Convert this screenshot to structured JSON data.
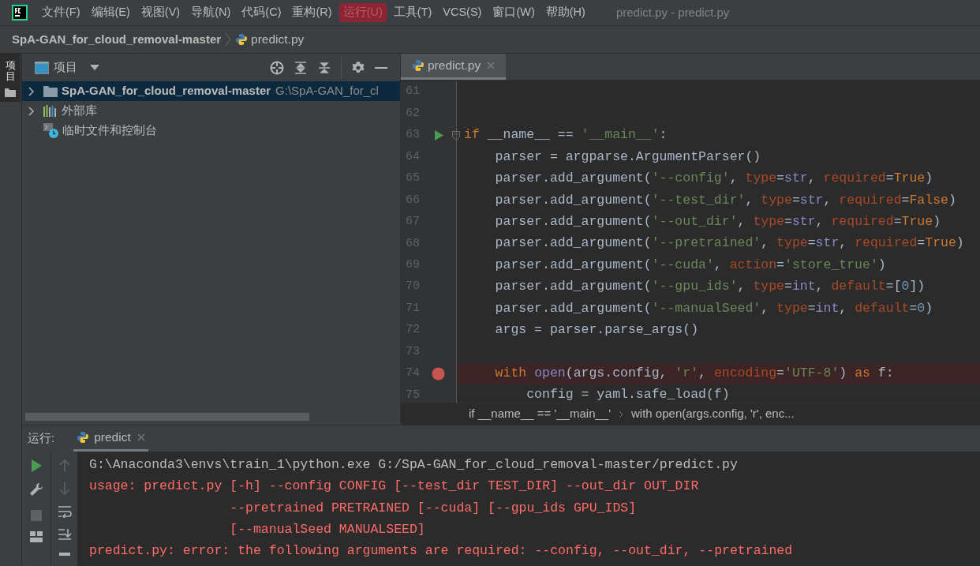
{
  "menu_bar": {
    "items": [
      {
        "label": "文件(F)",
        "selected": false
      },
      {
        "label": "编辑(E)",
        "selected": false
      },
      {
        "label": "视图(V)",
        "selected": false
      },
      {
        "label": "导航(N)",
        "selected": false
      },
      {
        "label": "代码(C)",
        "selected": false
      },
      {
        "label": "重构(R)",
        "selected": false
      },
      {
        "label": "运行(U)",
        "selected": true
      },
      {
        "label": "工具(T)",
        "selected": false
      },
      {
        "label": "VCS(S)",
        "selected": false
      },
      {
        "label": "窗口(W)",
        "selected": false
      },
      {
        "label": "帮助(H)",
        "selected": false
      }
    ],
    "window_title": "predict.py - predict.py"
  },
  "breadcrumb": {
    "project": "SpA-GAN_for_cloud_removal-master",
    "file": "predict.py"
  },
  "side_stripe": {
    "tab": "项目"
  },
  "project_panel": {
    "title": "项目",
    "tree": [
      {
        "kind": "folder",
        "label": "SpA-GAN_for_cloud_removal-master",
        "path": "G:\\SpA-GAN_for_cl",
        "expanded": false,
        "selected": true
      },
      {
        "kind": "library",
        "label": "外部库",
        "expanded": false,
        "selected": false
      },
      {
        "kind": "scratch",
        "label": "临时文件和控制台",
        "selected": false
      }
    ]
  },
  "editor": {
    "tabs": [
      {
        "label": "predict.py",
        "selected": true
      }
    ],
    "lines": [
      {
        "number": "61"
      },
      {
        "number": "62"
      },
      {
        "number": "63",
        "run_marker": true,
        "fold": true,
        "tokens": [
          {
            "kind": "keyword",
            "text": "if "
          },
          {
            "kind": "plain",
            "text": "__name__ == "
          },
          {
            "kind": "string",
            "text": "'__main__'"
          },
          {
            "kind": "plain",
            "text": ":"
          }
        ]
      },
      {
        "number": "64",
        "tokens": [
          {
            "kind": "plain",
            "text": "    parser = argparse.ArgumentParser()"
          }
        ]
      },
      {
        "number": "65",
        "tokens": [
          {
            "kind": "plain",
            "text": "    parser.add_argument("
          },
          {
            "kind": "string",
            "text": "'--config'"
          },
          {
            "kind": "plain",
            "text": ", "
          },
          {
            "kind": "param",
            "text": "type"
          },
          {
            "kind": "plain",
            "text": "="
          },
          {
            "kind": "builtin",
            "text": "str"
          },
          {
            "kind": "plain",
            "text": ", "
          },
          {
            "kind": "param",
            "text": "required"
          },
          {
            "kind": "plain",
            "text": "="
          },
          {
            "kind": "keyword",
            "text": "True"
          },
          {
            "kind": "plain",
            "text": ")"
          }
        ]
      },
      {
        "number": "66",
        "tokens": [
          {
            "kind": "plain",
            "text": "    parser.add_argument("
          },
          {
            "kind": "string",
            "text": "'--test_dir'"
          },
          {
            "kind": "plain",
            "text": ", "
          },
          {
            "kind": "param",
            "text": "type"
          },
          {
            "kind": "plain",
            "text": "="
          },
          {
            "kind": "builtin",
            "text": "str"
          },
          {
            "kind": "plain",
            "text": ", "
          },
          {
            "kind": "param",
            "text": "required"
          },
          {
            "kind": "plain",
            "text": "="
          },
          {
            "kind": "keyword",
            "text": "False"
          },
          {
            "kind": "plain",
            "text": ")"
          }
        ]
      },
      {
        "number": "67",
        "tokens": [
          {
            "kind": "plain",
            "text": "    parser.add_argument("
          },
          {
            "kind": "string",
            "text": "'--out_dir'"
          },
          {
            "kind": "plain",
            "text": ", "
          },
          {
            "kind": "param",
            "text": "type"
          },
          {
            "kind": "plain",
            "text": "="
          },
          {
            "kind": "builtin",
            "text": "str"
          },
          {
            "kind": "plain",
            "text": ", "
          },
          {
            "kind": "param",
            "text": "required"
          },
          {
            "kind": "plain",
            "text": "="
          },
          {
            "kind": "keyword",
            "text": "True"
          },
          {
            "kind": "plain",
            "text": ")"
          }
        ]
      },
      {
        "number": "68",
        "tokens": [
          {
            "kind": "plain",
            "text": "    parser.add_argument("
          },
          {
            "kind": "string",
            "text": "'--pretrained'"
          },
          {
            "kind": "plain",
            "text": ", "
          },
          {
            "kind": "param",
            "text": "type"
          },
          {
            "kind": "plain",
            "text": "="
          },
          {
            "kind": "builtin",
            "text": "str"
          },
          {
            "kind": "plain",
            "text": ", "
          },
          {
            "kind": "param",
            "text": "required"
          },
          {
            "kind": "plain",
            "text": "="
          },
          {
            "kind": "keyword",
            "text": "True"
          },
          {
            "kind": "plain",
            "text": ")"
          }
        ]
      },
      {
        "number": "69",
        "tokens": [
          {
            "kind": "plain",
            "text": "    parser.add_argument("
          },
          {
            "kind": "string",
            "text": "'--cuda'"
          },
          {
            "kind": "plain",
            "text": ", "
          },
          {
            "kind": "param",
            "text": "action"
          },
          {
            "kind": "plain",
            "text": "="
          },
          {
            "kind": "string",
            "text": "'store_true'"
          },
          {
            "kind": "plain",
            "text": ")"
          }
        ]
      },
      {
        "number": "70",
        "tokens": [
          {
            "kind": "plain",
            "text": "    parser.add_argument("
          },
          {
            "kind": "string",
            "text": "'--gpu_ids'"
          },
          {
            "kind": "plain",
            "text": ", "
          },
          {
            "kind": "param",
            "text": "type"
          },
          {
            "kind": "plain",
            "text": "="
          },
          {
            "kind": "builtin",
            "text": "int"
          },
          {
            "kind": "plain",
            "text": ", "
          },
          {
            "kind": "param",
            "text": "default"
          },
          {
            "kind": "plain",
            "text": "=["
          },
          {
            "kind": "number",
            "text": "0"
          },
          {
            "kind": "plain",
            "text": "])"
          }
        ]
      },
      {
        "number": "71",
        "tokens": [
          {
            "kind": "plain",
            "text": "    parser.add_argument("
          },
          {
            "kind": "string",
            "text": "'--manualSeed'"
          },
          {
            "kind": "plain",
            "text": ", "
          },
          {
            "kind": "param",
            "text": "type"
          },
          {
            "kind": "plain",
            "text": "="
          },
          {
            "kind": "builtin",
            "text": "int"
          },
          {
            "kind": "plain",
            "text": ", "
          },
          {
            "kind": "param",
            "text": "default"
          },
          {
            "kind": "plain",
            "text": "="
          },
          {
            "kind": "number",
            "text": "0"
          },
          {
            "kind": "plain",
            "text": ")"
          }
        ]
      },
      {
        "number": "72",
        "tokens": [
          {
            "kind": "plain",
            "text": "    args = parser.parse_args()"
          }
        ]
      },
      {
        "number": "73"
      },
      {
        "number": "74",
        "breakpoint": true,
        "highlighted": true,
        "tokens": [
          {
            "kind": "keyword",
            "text": "    with "
          },
          {
            "kind": "builtin",
            "text": "open"
          },
          {
            "kind": "plain",
            "text": "(args.config, "
          },
          {
            "kind": "string",
            "text": "'r'"
          },
          {
            "kind": "plain",
            "text": ", "
          },
          {
            "kind": "param",
            "text": "encoding"
          },
          {
            "kind": "plain",
            "text": "="
          },
          {
            "kind": "string",
            "text": "'UTF-8'"
          },
          {
            "kind": "plain",
            "text": ") "
          },
          {
            "kind": "keyword",
            "text": "as "
          },
          {
            "kind": "plain",
            "text": "f:"
          }
        ]
      },
      {
        "number": "75",
        "tokens": [
          {
            "kind": "plain",
            "text": "        config = yaml.safe_load(f)"
          }
        ]
      }
    ],
    "breadcrumbs": [
      "if __name__ == '__main__'",
      "with open(args.config, 'r', enc..."
    ]
  },
  "run_panel": {
    "label": "运行:",
    "tabs": [
      {
        "label": "predict",
        "selected": true
      }
    ],
    "console": [
      {
        "kind": "command",
        "text": "G:\\Anaconda3\\envs\\train_1\\python.exe G:/SpA-GAN_for_cloud_removal-master/predict.py"
      },
      {
        "kind": "error",
        "text": "usage: predict.py [-h] --config CONFIG [--test_dir TEST_DIR] --out_dir OUT_DIR"
      },
      {
        "kind": "error",
        "text": "                  --pretrained PRETRAINED [--cuda] [--gpu_ids GPU_IDS]"
      },
      {
        "kind": "error",
        "text": "                  [--manualSeed MANUALSEED]"
      },
      {
        "kind": "error",
        "text": "predict.py: error: the following arguments are required: --config, --out_dir, --pretrained"
      }
    ]
  }
}
